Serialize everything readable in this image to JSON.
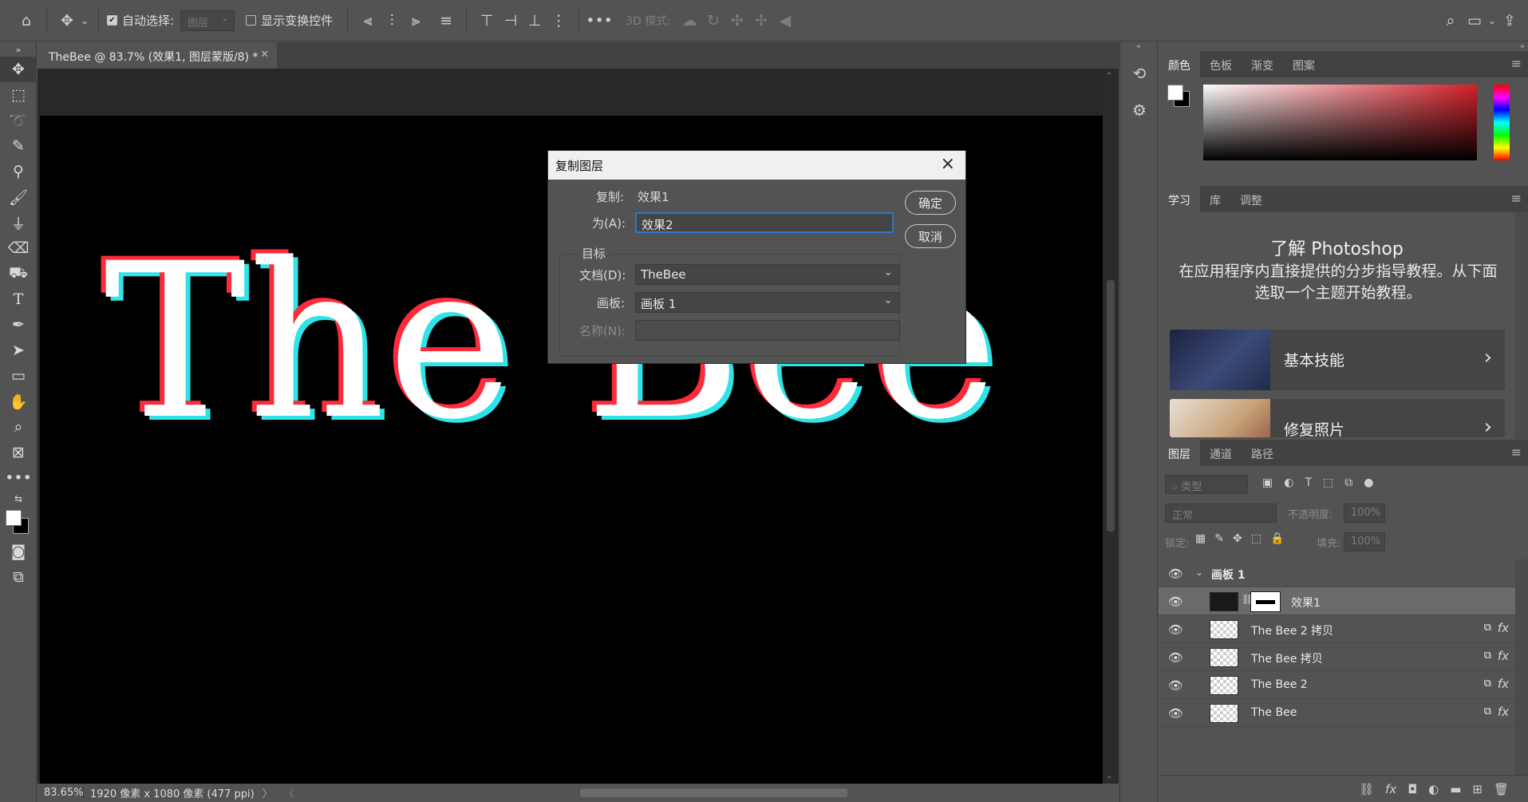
{
  "options_bar": {
    "auto_select_label": "自动选择:",
    "auto_select_checked": true,
    "auto_select_target": "图层",
    "show_transform_label": "显示变换控件",
    "mode_3d_label": "3D 模式:"
  },
  "document": {
    "tab_title": "TheBee @ 83.7% (效果1, 图层蒙版/8) *",
    "canvas_text": "The Bee",
    "zoom": "83.65%",
    "size_info": "1920 像素 x 1080 像素 (477 ppi)"
  },
  "dialog": {
    "title": "复制图层",
    "duplicate_label": "复制:",
    "duplicate_value": "效果1",
    "as_label": "为(A):",
    "as_value": "效果2",
    "destination_label": "目标",
    "document_label": "文档(D):",
    "document_value": "TheBee",
    "artboard_label": "画板:",
    "artboard_value": "画板 1",
    "name_label": "名称(N):",
    "ok_label": "确定",
    "cancel_label": "取消"
  },
  "color_panel": {
    "tabs": [
      "颜色",
      "色板",
      "渐变",
      "图案"
    ],
    "foreground": "#ffffff",
    "background": "#000000",
    "hue_color": "#d4202a"
  },
  "learn_panel": {
    "tabs": [
      "学习",
      "库",
      "调整"
    ],
    "title": "了解 Photoshop",
    "description": "在应用程序内直接提供的分步指导教程。从下面选取一个主题开始教程。",
    "cards": [
      {
        "label": "基本技能"
      },
      {
        "label": "修复照片"
      }
    ]
  },
  "layers_panel": {
    "tabs": [
      "图层",
      "通道",
      "路径"
    ],
    "filter_placeholder": "类型",
    "blend_mode": "正常",
    "opacity_label": "不透明度:",
    "opacity_value": "100%",
    "lock_label": "锁定:",
    "fill_label": "填充:",
    "fill_value": "100%",
    "group_name": "画板 1",
    "layers": [
      {
        "name": "效果1",
        "selected": true,
        "has_fx": false
      },
      {
        "name": "The Bee 2 拷贝",
        "selected": false,
        "has_fx": true
      },
      {
        "name": "The Bee 拷贝",
        "selected": false,
        "has_fx": true
      },
      {
        "name": "The Bee 2",
        "selected": false,
        "has_fx": true
      },
      {
        "name": "The Bee",
        "selected": false,
        "has_fx": true
      }
    ],
    "fx_label": "fx"
  }
}
